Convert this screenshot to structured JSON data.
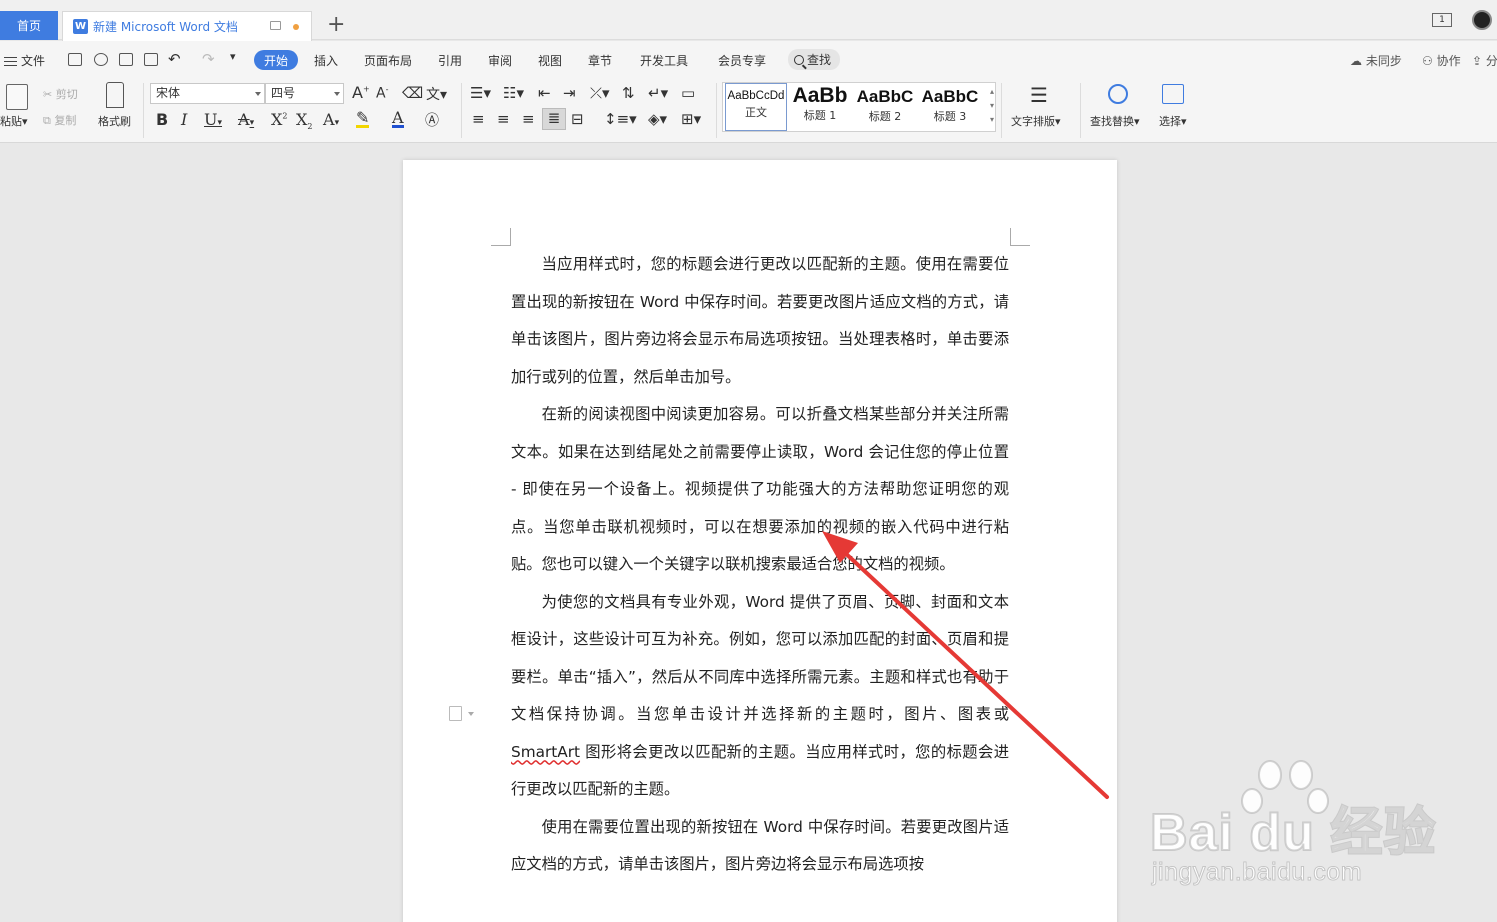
{
  "tabs": {
    "home": "首页",
    "doc_icon": "W",
    "doc_title": "新建 Microsoft Word 文档",
    "add": "+",
    "page_indicator": "1"
  },
  "menu": {
    "file": "文件",
    "items": [
      "开始",
      "插入",
      "页面布局",
      "引用",
      "审阅",
      "视图",
      "章节",
      "开发工具",
      "会员专享"
    ],
    "search": "查找",
    "right": [
      "未同步",
      "协作",
      "分享"
    ]
  },
  "ribbon": {
    "paste": "粘贴",
    "cut": "剪切",
    "copy": "复制",
    "format_painter": "格式刷",
    "font_name": "宋体",
    "font_size": "四号",
    "styles": [
      {
        "preview": "AaBbCcDd",
        "name": "正文"
      },
      {
        "preview": "AaBb",
        "name": "标题 1"
      },
      {
        "preview": "AaBbC",
        "name": "标题 2"
      },
      {
        "preview": "AaBbC",
        "name": "标题 3"
      }
    ],
    "text_layout": "文字排版",
    "find_replace": "查找替换",
    "select": "选择"
  },
  "document": {
    "p1": "当应用样式时，您的标题会进行更改以匹配新的主题。使用在需要位置出现的新按钮在 Word 中保存时间。若要更改图片适应文档的方式，请单击该图片，图片旁边将会显示布局选项按钮。当处理表格时，单击要添加行或列的位置，然后单击加号。",
    "p2": "在新的阅读视图中阅读更加容易。可以折叠文档某些部分并关注所需文本。如果在达到结尾处之前需要停止读取，Word 会记住您的停止位置 - 即使在另一个设备上。视频提供了功能强大的方法帮助您证明您的观点。当您单击联机视频时，可以在想要添加的视频的嵌入代码中进行粘贴。您也可以键入一个关键字以联机搜索最适合您的文档的视频。",
    "p3a": "为使您的文档具有专业外观，Word 提供了页眉、页脚、封面和文本框设计，这些设计可互为补充。例如，您可以添加匹配的封面、页眉和提要栏。单击“插入”，然后从不同库中选择所需元素。主题和样式也有助于文档保持协调。当您单击设计并选择新的主题时，图片、图表或 ",
    "p3_smartart": "SmartArt",
    "p3b": " 图形将会更改以匹配新的主题。当应用样式时，您的标题会进行更改以匹配新的主题。",
    "p4": "使用在需要位置出现的新按钮在 Word 中保存时间。若要更改图片适应文档的方式，请单击该图片，图片旁边将会显示布局选项按"
  },
  "watermark": {
    "brand": "Bai du 经验",
    "url": "jingyan.baidu.com"
  },
  "colors": {
    "accent": "#3f7ce0",
    "arrow": "#e53935"
  }
}
